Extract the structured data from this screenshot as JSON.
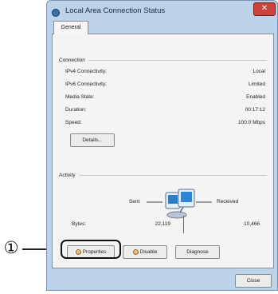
{
  "callout": {
    "number": "①"
  },
  "window": {
    "title": "Local Area Connection Status",
    "close_glyph": "✕"
  },
  "tabs": [
    {
      "label": "General",
      "selected": true
    }
  ],
  "connection": {
    "heading": "Connection",
    "rows": [
      {
        "label": "IPv4 Connectivity:",
        "value": "Local"
      },
      {
        "label": "IPv6 Connectivity:",
        "value": "Limited"
      },
      {
        "label": "Media State:",
        "value": "Enabled"
      },
      {
        "label": "Duration:",
        "value": "00:17:12"
      },
      {
        "label": "Speed:",
        "value": "100.0 Mbps"
      }
    ],
    "details_button": "Details..."
  },
  "activity": {
    "heading": "Activity",
    "sent_label": "Sent",
    "received_label": "Received",
    "bytes_label": "Bytes:",
    "bytes_sent": "22,119",
    "bytes_received": "10,466",
    "icon": "network-activity-icon"
  },
  "buttons": {
    "properties": "Properties",
    "disable": "Disable",
    "diagnose": "Diagnose",
    "close": "Close"
  },
  "colors": {
    "frame": "#bcd3ea",
    "panel": "#f4f4f4",
    "close_button": "#c8443a",
    "highlight_outline": "#111111"
  }
}
